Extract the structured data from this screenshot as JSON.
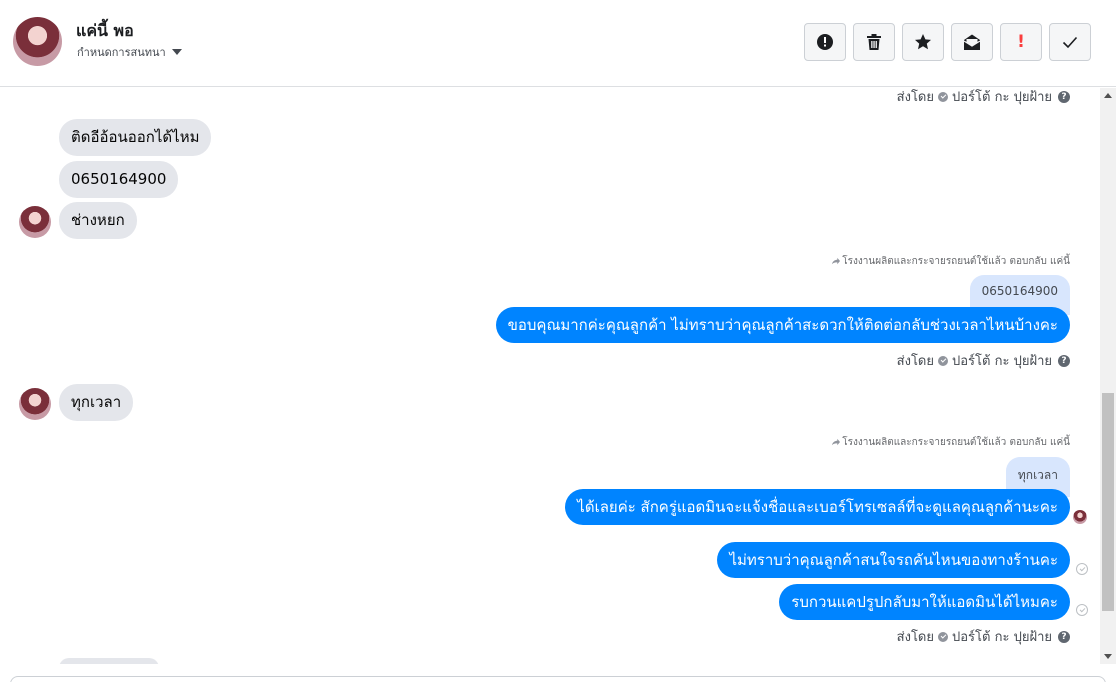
{
  "header": {
    "contact_name": "แค่นี้ พอ",
    "conversation_settings_label": "กำหนดการสนทนา",
    "toolbar": [
      {
        "name": "report-spam-button",
        "icon": "alert-circle-icon"
      },
      {
        "name": "delete-button",
        "icon": "trash-icon"
      },
      {
        "name": "star-button",
        "icon": "star-icon"
      },
      {
        "name": "mark-unread-button",
        "icon": "envelope-open-icon"
      },
      {
        "name": "follow-up-button",
        "icon": "exclamation-icon"
      },
      {
        "name": "mark-done-button",
        "icon": "check-icon"
      }
    ]
  },
  "messages": {
    "sent_by_label": "ส่งโดย",
    "agent_name": "ปอร์โต้ กะ ปุยฝ้าย",
    "help_glyph": "?",
    "incoming": [
      {
        "text": "ติดอีอ้อนออกได้ไหม"
      },
      {
        "text": "0650164900"
      },
      {
        "text": "ช่างหยก"
      },
      {
        "text": "ทุกเวลา"
      }
    ],
    "reply_note": "โรงงานผลิตและกระจายรถยนต์ใช้แล้ว ตอบกลับ แค่นี้",
    "quote_1": "0650164900",
    "outgoing_1": "ขอบคุณมากค่ะคุณลูกค้า ไม่ทราบว่าคุณลูกค้าสะดวกให้ติดต่อกลับช่วงเวลาไหนบ้างคะ",
    "quote_2": "ทุกเวลา",
    "outgoing_2": "ได้เลยค่ะ สักครู่แอดมินจะแจ้งชื่อและเบอร์โทรเซลล์ที่จะดูแลคุณลูกค้านะคะ",
    "outgoing_3": "ไม่ทราบว่าคุณลูกค้าสนใจรถคันไหนของทางร้านคะ",
    "outgoing_4": "รบกวนแคปรูปกลับมาให้แอดมินได้ไหมคะ"
  },
  "colors": {
    "outgoing_bubble": "#0084ff",
    "incoming_bubble": "#e4e6eb",
    "quoted_bubble": "#d8e6fd"
  }
}
